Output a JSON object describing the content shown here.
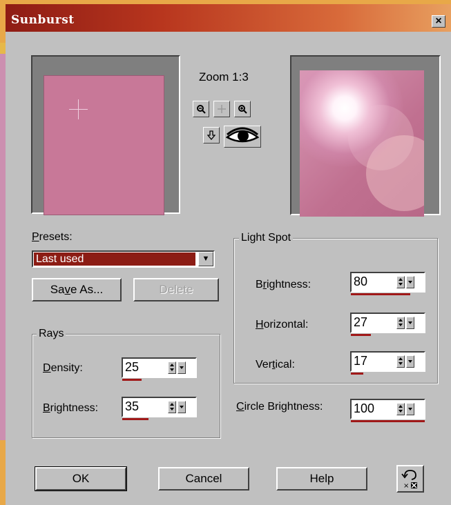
{
  "dialog": {
    "title": "Sunburst",
    "close_label": "×"
  },
  "preview": {
    "zoom_label": "Zoom 1:3",
    "zoom_out_icon": "zoom-out-icon",
    "pan_icon": "pan-icon",
    "zoom_in_icon": "zoom-in-icon",
    "navigate_icon": "down-arrow-icon",
    "proof_icon": "eye-icon"
  },
  "presets": {
    "label_prefix": "",
    "label_accel": "P",
    "label_rest": "resets:",
    "selected": "Last used",
    "save_as_prefix": "Sa",
    "save_as_accel": "v",
    "save_as_rest": "e As...",
    "delete_label": "Delete"
  },
  "rays": {
    "group_title": "Rays",
    "density_accel": "D",
    "density_rest": "ensity:",
    "density_value": "25",
    "brightness_accel": "B",
    "brightness_rest": "rightness:",
    "brightness_value": "35"
  },
  "light_spot": {
    "group_title": "Light Spot",
    "brightness_prefix": "B",
    "brightness_accel": "r",
    "brightness_rest": "ightness:",
    "brightness_value": "80",
    "horizontal_accel": "H",
    "horizontal_rest": "orizontal:",
    "horizontal_value": "27",
    "vertical_prefix": "Ver",
    "vertical_accel": "t",
    "vertical_rest": "ical:",
    "vertical_value": "17"
  },
  "circle": {
    "label_accel": "C",
    "label_rest": "ircle Brightness:",
    "value": "100"
  },
  "buttons": {
    "ok": "OK",
    "cancel": "Cancel",
    "help": "Help",
    "reset_icon": "reset-icon"
  },
  "colors": {
    "title_bar": "#8e1c14",
    "selection": "#8c1c14",
    "value_bar": "#a01818",
    "preview": "#c87898"
  }
}
